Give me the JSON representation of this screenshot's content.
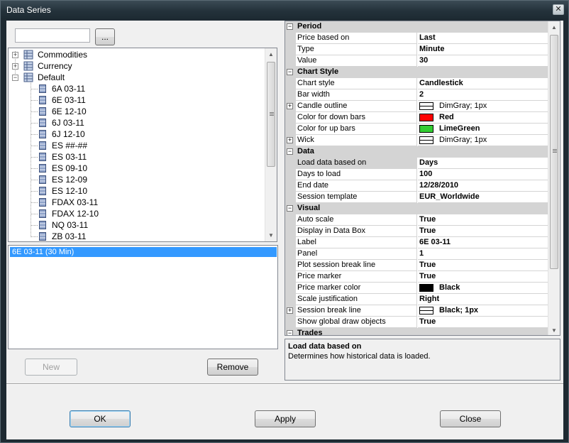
{
  "window": {
    "title": "Data Series",
    "close_label": "✕"
  },
  "search": {
    "value": "",
    "browse_label": "..."
  },
  "tree": {
    "groups": [
      {
        "label": "Commodities",
        "expander": "+"
      },
      {
        "label": "Currency",
        "expander": "+"
      },
      {
        "label": "Default",
        "expander": "−"
      }
    ],
    "items": [
      "6A 03-11",
      "6E 03-11",
      "6E 12-10",
      "6J 03-11",
      "6J 12-10",
      "ES ##-##",
      "ES 03-11",
      "ES 09-10",
      "ES 12-09",
      "ES 12-10",
      "FDAX 03-11",
      "FDAX 12-10",
      "NQ 03-11",
      "ZB 03-11"
    ]
  },
  "selected": {
    "items": [
      "6E 03-11 (30 Min)"
    ]
  },
  "buttons": {
    "new": "New",
    "remove": "Remove",
    "ok": "OK",
    "apply": "Apply",
    "close": "Close"
  },
  "properties": {
    "period": {
      "title": "Period",
      "collapse": "−",
      "rows": [
        {
          "name": "Price based on",
          "value": "Last"
        },
        {
          "name": "Type",
          "value": "Minute"
        },
        {
          "name": "Value",
          "value": "30"
        }
      ]
    },
    "chart_style": {
      "title": "Chart Style",
      "collapse": "−",
      "style": {
        "name": "Chart style",
        "value": "Candlestick"
      },
      "bar_width": {
        "name": "Bar width",
        "value": "2"
      },
      "candle_outline": {
        "name": "Candle outline",
        "value": "DimGray; 1px",
        "expand": "+"
      },
      "down_bars": {
        "name": "Color for down bars",
        "value": "Red",
        "color": "#ff0000"
      },
      "up_bars": {
        "name": "Color for up bars",
        "value": "LimeGreen",
        "color": "#32cd32"
      },
      "wick": {
        "name": "Wick",
        "value": "DimGray; 1px",
        "expand": "+"
      }
    },
    "data": {
      "title": "Data",
      "collapse": "−",
      "rows": [
        {
          "name": "Load data based on",
          "value": "Days"
        },
        {
          "name": "Days to load",
          "value": "100"
        },
        {
          "name": "End date",
          "value": "12/28/2010"
        },
        {
          "name": "Session template",
          "value": "EUR_Worldwide"
        }
      ]
    },
    "visual": {
      "title": "Visual",
      "collapse": "−",
      "auto_scale": {
        "name": "Auto scale",
        "value": "True"
      },
      "data_box": {
        "name": "Display in Data Box",
        "value": "True"
      },
      "label": {
        "name": "Label",
        "value": "6E 03-11"
      },
      "panel": {
        "name": "Panel",
        "value": "1"
      },
      "session_line": {
        "name": "Plot session break line",
        "value": "True"
      },
      "price_marker": {
        "name": "Price marker",
        "value": "True"
      },
      "price_marker_color": {
        "name": "Price marker color",
        "value": "Black",
        "color": "#000000"
      },
      "scale_just": {
        "name": "Scale justification",
        "value": "Right"
      },
      "session_break": {
        "name": "Session break line",
        "value": "Black; 1px",
        "expand": "+"
      },
      "global_draw": {
        "name": "Show global draw objects",
        "value": "True"
      }
    },
    "trades": {
      "title": "Trades",
      "collapse": "−"
    }
  },
  "description": {
    "title": "Load data based on",
    "text": "Determines how historical data is loaded."
  }
}
